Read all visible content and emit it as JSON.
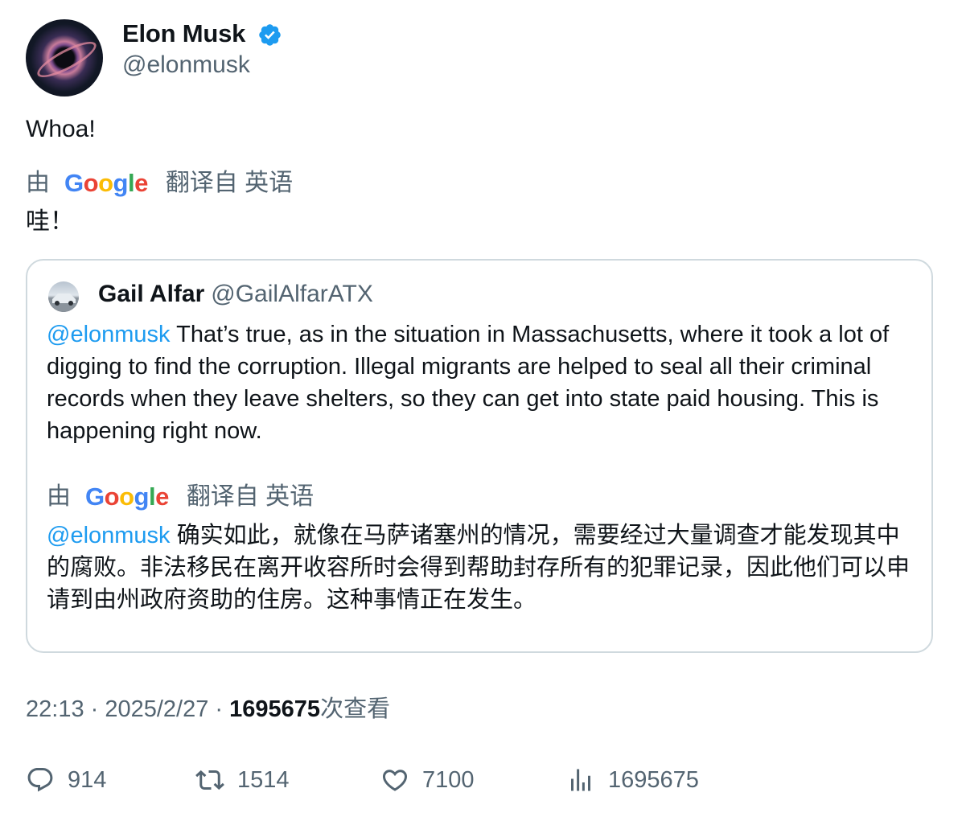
{
  "author": {
    "name": "Elon Musk",
    "handle": "@elonmusk",
    "verified_icon": "verified-badge-icon",
    "accent_color": "#1d9bf0"
  },
  "tweet": {
    "text": "Whoa!",
    "translation": {
      "prefix": "由",
      "provider": "Google",
      "suffix": "翻译自 英语",
      "text": "哇！"
    }
  },
  "quoted": {
    "name": "Gail Alfar",
    "handle": "@GailAlfarATX",
    "mention": "@elonmusk",
    "text": "That’s true, as in the situation in Massachusetts, where it took a lot of digging to find the corruption. Illegal migrants are helped to seal all their criminal records when they leave shelters, so they can get into state paid housing. This is happening right now.",
    "translation": {
      "prefix": "由",
      "provider": "Google",
      "suffix": "翻译自 英语",
      "mention": "@elonmusk",
      "text": "确实如此，就像在马萨诸塞州的情况，需要经过大量调查才能发现其中的腐败。非法移民在离开收容所时会得到帮助封存所有的犯罪记录，因此他们可以申请到由州政府资助的住房。这种事情正在发生。"
    }
  },
  "meta": {
    "time": "22:13",
    "sep1": " · ",
    "date": "2025/2/27",
    "sep2": " · ",
    "views": "1695675",
    "views_label": "次查看"
  },
  "actions": {
    "replies": "914",
    "retweets": "1514",
    "likes": "7100",
    "views": "1695675"
  }
}
